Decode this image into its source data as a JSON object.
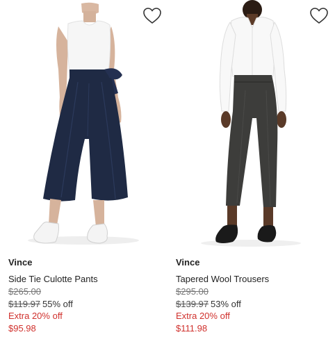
{
  "products": [
    {
      "brand": "Vince",
      "name": "Side Tie Culotte Pants",
      "compare_price": "$265.00",
      "was_price": "$119.97",
      "discount": "55% off",
      "promo": "Extra 20% off",
      "final_price": "$95.98",
      "image_icon": "product-photo-culotte-pants"
    },
    {
      "brand": "Vince",
      "name": "Tapered Wool Trousers",
      "compare_price": "$295.00",
      "was_price": "$139.97",
      "discount": "53% off",
      "promo": "Extra 20% off",
      "final_price": "$111.98",
      "image_icon": "product-photo-wool-trousers"
    }
  ],
  "colors": {
    "sale_red": "#d0312d",
    "navy": "#1f2a44",
    "charcoal": "#3d3d3b"
  }
}
